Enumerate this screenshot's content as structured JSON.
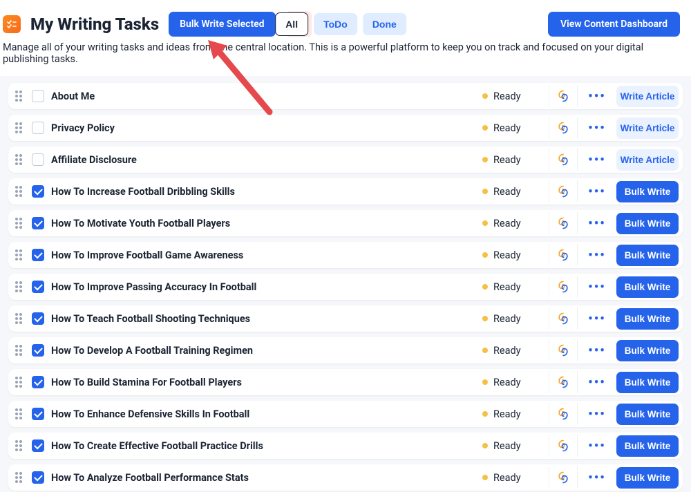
{
  "header": {
    "title": "My Writing Tasks",
    "bulk_write_label": "Bulk Write Selected",
    "dashboard_label": "View Content Dashboard",
    "subtitle": "Manage all of your writing tasks and ideas from one central location. This is a powerful platform to keep you on track and focused on your digital publishing tasks."
  },
  "filters": {
    "all": "All",
    "todo": "ToDo",
    "done": "Done"
  },
  "actions": {
    "write_article": "Write Article",
    "bulk_write": "Bulk Write"
  },
  "status_label": "Ready",
  "tasks": [
    {
      "title": "About Me",
      "checked": false,
      "action": "write_article"
    },
    {
      "title": "Privacy Policy",
      "checked": false,
      "action": "write_article"
    },
    {
      "title": "Affiliate Disclosure",
      "checked": false,
      "action": "write_article"
    },
    {
      "title": "How To Increase Football Dribbling Skills",
      "checked": true,
      "action": "bulk_write"
    },
    {
      "title": "How To Motivate Youth Football Players",
      "checked": true,
      "action": "bulk_write"
    },
    {
      "title": "How To Improve Football Game Awareness",
      "checked": true,
      "action": "bulk_write"
    },
    {
      "title": "How To Improve Passing Accuracy In Football",
      "checked": true,
      "action": "bulk_write"
    },
    {
      "title": "How To Teach Football Shooting Techniques",
      "checked": true,
      "action": "bulk_write"
    },
    {
      "title": "How To Develop A Football Training Regimen",
      "checked": true,
      "action": "bulk_write"
    },
    {
      "title": "How To Build Stamina For Football Players",
      "checked": true,
      "action": "bulk_write"
    },
    {
      "title": "How To Enhance Defensive Skills In Football",
      "checked": true,
      "action": "bulk_write"
    },
    {
      "title": "How To Create Effective Football Practice Drills",
      "checked": true,
      "action": "bulk_write"
    },
    {
      "title": "How To Analyze Football Performance Stats",
      "checked": true,
      "action": "bulk_write"
    }
  ]
}
